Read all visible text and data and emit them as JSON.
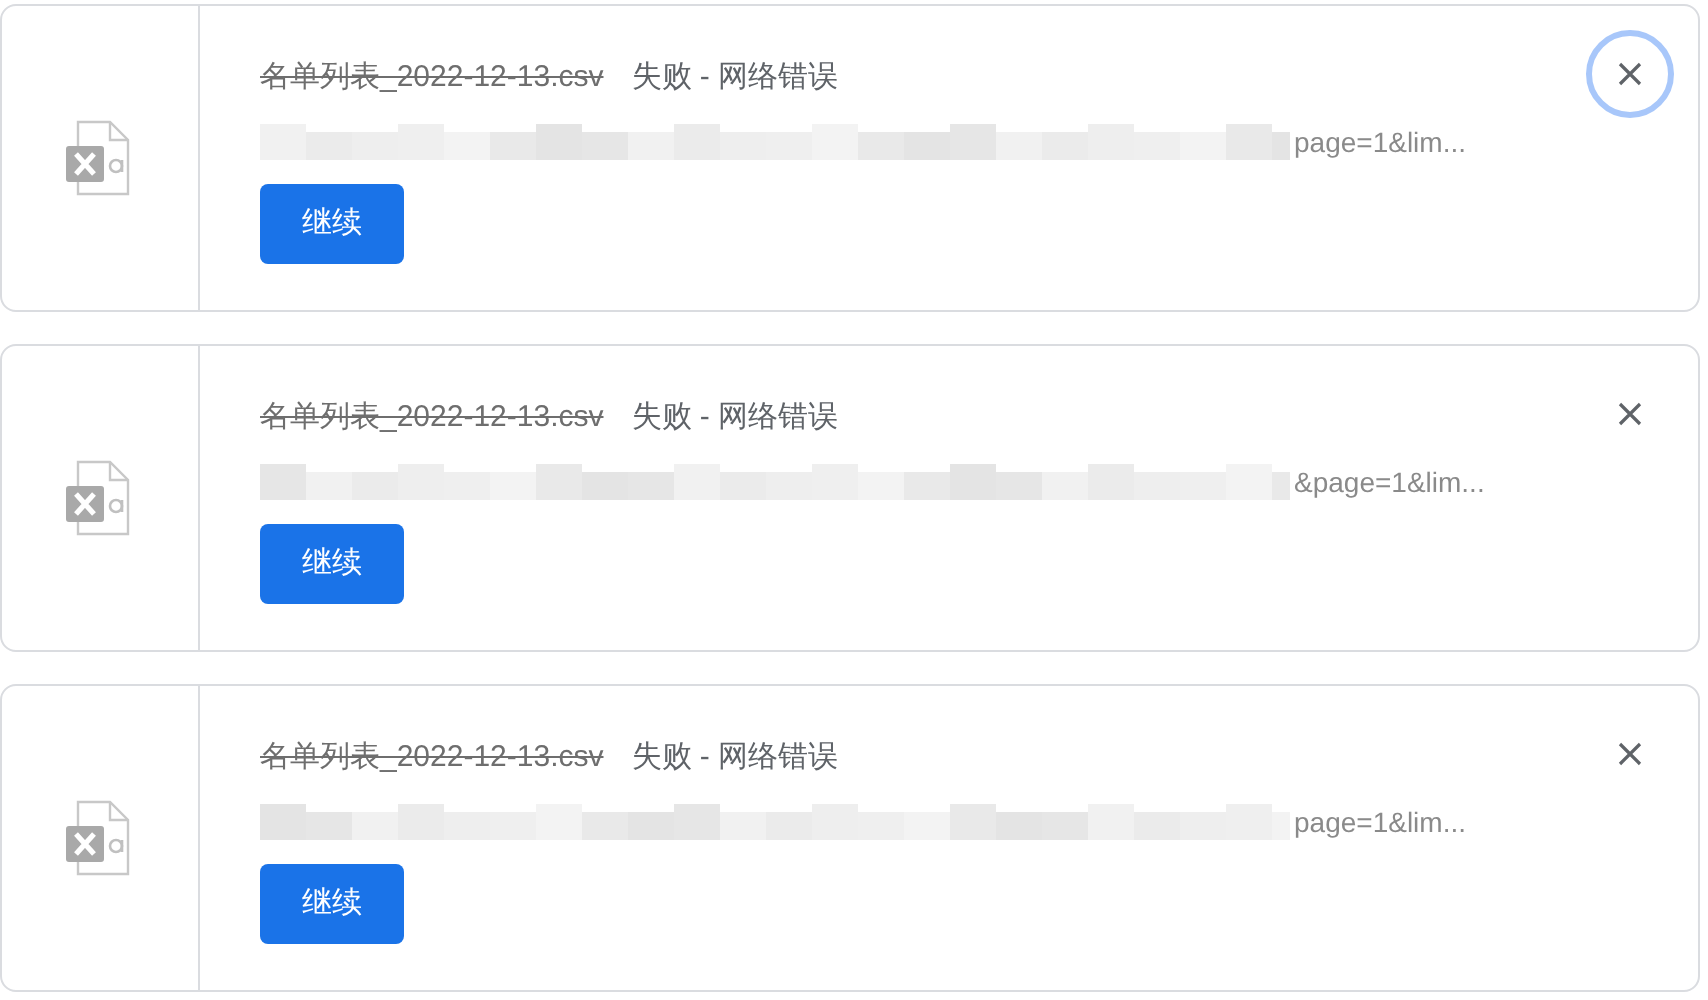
{
  "downloads": [
    {
      "file_name": "名单列表_2022-12-13.csv",
      "file_struck": true,
      "status": "失败 - 网络错误",
      "url_tail": "page=1&lim...",
      "button": "继续",
      "close_focused": true
    },
    {
      "file_name": "名单列表_2022-12-13.csv",
      "file_struck": true,
      "status": "失败 - 网络错误",
      "url_tail": "&page=1&lim...",
      "button": "继续",
      "close_focused": false
    },
    {
      "file_name": "名单列表_2022-12-13.csv",
      "file_struck": true,
      "status": "失败 - 网络错误",
      "url_tail": "page=1&lim...",
      "button": "继续",
      "close_focused": false
    }
  ]
}
